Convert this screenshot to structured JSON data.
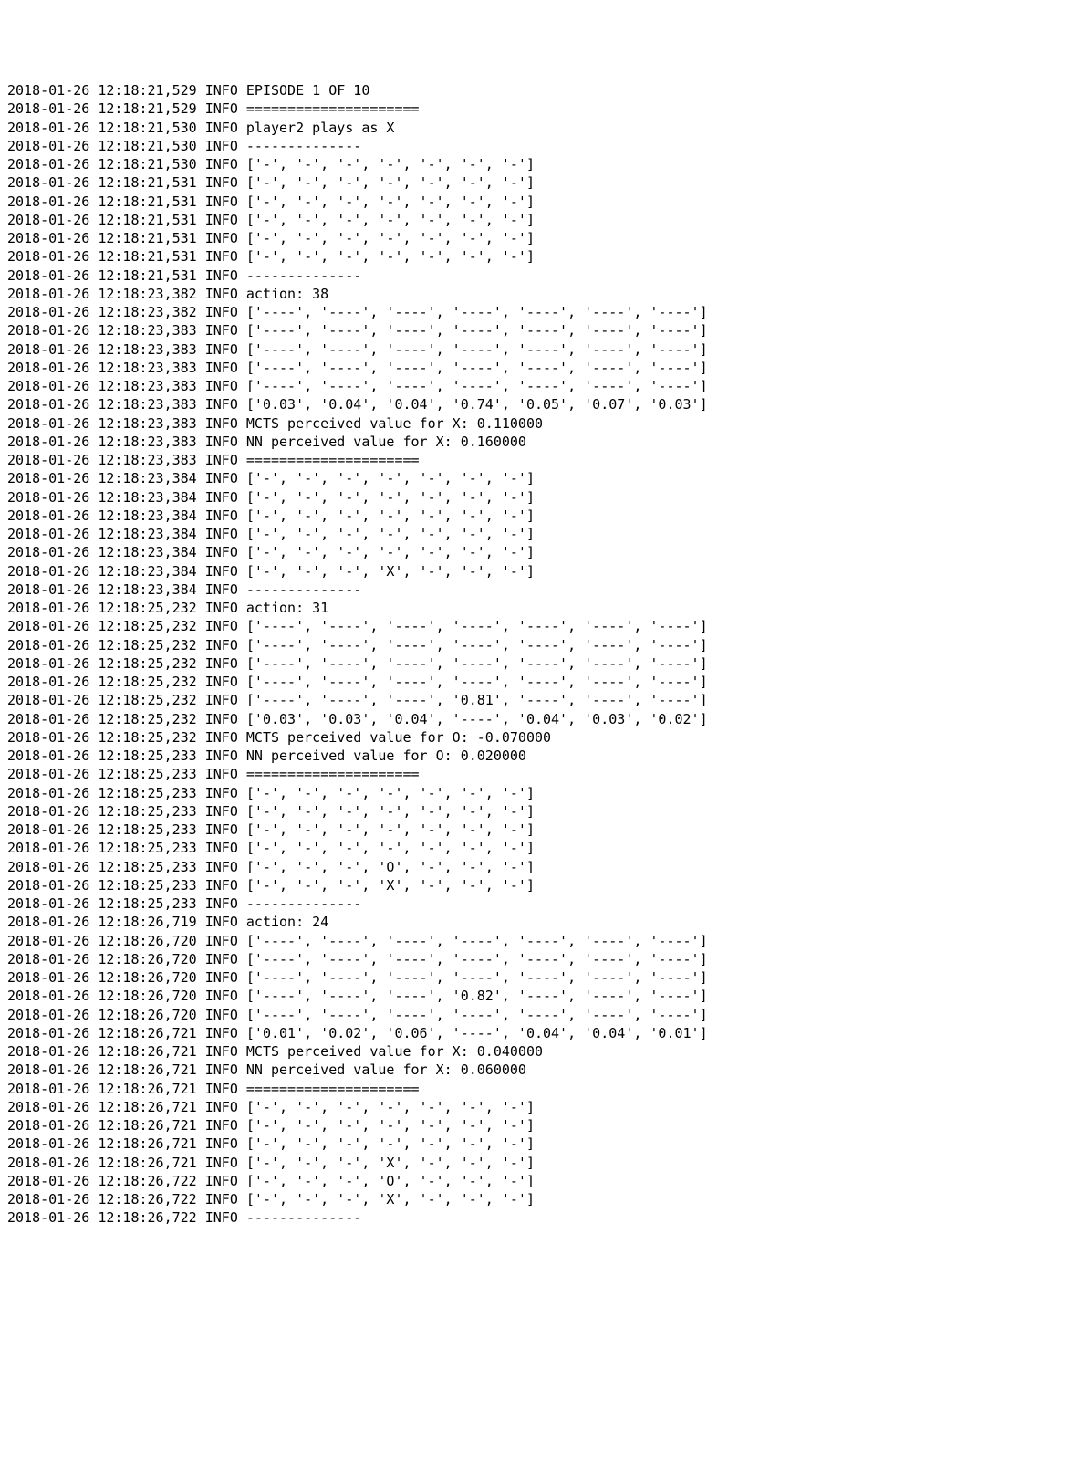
{
  "log_lines": [
    {
      "ts": "2018-01-26 12:18:21,529",
      "level": "INFO",
      "msg": "EPISODE 1 OF 10"
    },
    {
      "ts": "2018-01-26 12:18:21,529",
      "level": "INFO",
      "msg": "====================="
    },
    {
      "ts": "2018-01-26 12:18:21,530",
      "level": "INFO",
      "msg": "player2 plays as X"
    },
    {
      "ts": "2018-01-26 12:18:21,530",
      "level": "INFO",
      "msg": "--------------"
    },
    {
      "ts": "2018-01-26 12:18:21,530",
      "level": "INFO",
      "msg": "['-', '-', '-', '-', '-', '-', '-']"
    },
    {
      "ts": "2018-01-26 12:18:21,531",
      "level": "INFO",
      "msg": "['-', '-', '-', '-', '-', '-', '-']"
    },
    {
      "ts": "2018-01-26 12:18:21,531",
      "level": "INFO",
      "msg": "['-', '-', '-', '-', '-', '-', '-']"
    },
    {
      "ts": "2018-01-26 12:18:21,531",
      "level": "INFO",
      "msg": "['-', '-', '-', '-', '-', '-', '-']"
    },
    {
      "ts": "2018-01-26 12:18:21,531",
      "level": "INFO",
      "msg": "['-', '-', '-', '-', '-', '-', '-']"
    },
    {
      "ts": "2018-01-26 12:18:21,531",
      "level": "INFO",
      "msg": "['-', '-', '-', '-', '-', '-', '-']"
    },
    {
      "ts": "2018-01-26 12:18:21,531",
      "level": "INFO",
      "msg": "--------------"
    },
    {
      "ts": "2018-01-26 12:18:23,382",
      "level": "INFO",
      "msg": "action: 38"
    },
    {
      "ts": "2018-01-26 12:18:23,382",
      "level": "INFO",
      "msg": "['----', '----', '----', '----', '----', '----', '----']"
    },
    {
      "ts": "2018-01-26 12:18:23,383",
      "level": "INFO",
      "msg": "['----', '----', '----', '----', '----', '----', '----']"
    },
    {
      "ts": "2018-01-26 12:18:23,383",
      "level": "INFO",
      "msg": "['----', '----', '----', '----', '----', '----', '----']"
    },
    {
      "ts": "2018-01-26 12:18:23,383",
      "level": "INFO",
      "msg": "['----', '----', '----', '----', '----', '----', '----']"
    },
    {
      "ts": "2018-01-26 12:18:23,383",
      "level": "INFO",
      "msg": "['----', '----', '----', '----', '----', '----', '----']"
    },
    {
      "ts": "2018-01-26 12:18:23,383",
      "level": "INFO",
      "msg": "['0.03', '0.04', '0.04', '0.74', '0.05', '0.07', '0.03']"
    },
    {
      "ts": "2018-01-26 12:18:23,383",
      "level": "INFO",
      "msg": "MCTS perceived value for X: 0.110000"
    },
    {
      "ts": "2018-01-26 12:18:23,383",
      "level": "INFO",
      "msg": "NN perceived value for X: 0.160000"
    },
    {
      "ts": "2018-01-26 12:18:23,383",
      "level": "INFO",
      "msg": "====================="
    },
    {
      "ts": "2018-01-26 12:18:23,384",
      "level": "INFO",
      "msg": "['-', '-', '-', '-', '-', '-', '-']"
    },
    {
      "ts": "2018-01-26 12:18:23,384",
      "level": "INFO",
      "msg": "['-', '-', '-', '-', '-', '-', '-']"
    },
    {
      "ts": "2018-01-26 12:18:23,384",
      "level": "INFO",
      "msg": "['-', '-', '-', '-', '-', '-', '-']"
    },
    {
      "ts": "2018-01-26 12:18:23,384",
      "level": "INFO",
      "msg": "['-', '-', '-', '-', '-', '-', '-']"
    },
    {
      "ts": "2018-01-26 12:18:23,384",
      "level": "INFO",
      "msg": "['-', '-', '-', '-', '-', '-', '-']"
    },
    {
      "ts": "2018-01-26 12:18:23,384",
      "level": "INFO",
      "msg": "['-', '-', '-', 'X', '-', '-', '-']"
    },
    {
      "ts": "2018-01-26 12:18:23,384",
      "level": "INFO",
      "msg": "--------------"
    },
    {
      "ts": "2018-01-26 12:18:25,232",
      "level": "INFO",
      "msg": "action: 31"
    },
    {
      "ts": "2018-01-26 12:18:25,232",
      "level": "INFO",
      "msg": "['----', '----', '----', '----', '----', '----', '----']"
    },
    {
      "ts": "2018-01-26 12:18:25,232",
      "level": "INFO",
      "msg": "['----', '----', '----', '----', '----', '----', '----']"
    },
    {
      "ts": "2018-01-26 12:18:25,232",
      "level": "INFO",
      "msg": "['----', '----', '----', '----', '----', '----', '----']"
    },
    {
      "ts": "2018-01-26 12:18:25,232",
      "level": "INFO",
      "msg": "['----', '----', '----', '----', '----', '----', '----']"
    },
    {
      "ts": "2018-01-26 12:18:25,232",
      "level": "INFO",
      "msg": "['----', '----', '----', '0.81', '----', '----', '----']"
    },
    {
      "ts": "2018-01-26 12:18:25,232",
      "level": "INFO",
      "msg": "['0.03', '0.03', '0.04', '----', '0.04', '0.03', '0.02']"
    },
    {
      "ts": "2018-01-26 12:18:25,232",
      "level": "INFO",
      "msg": "MCTS perceived value for O: -0.070000"
    },
    {
      "ts": "2018-01-26 12:18:25,233",
      "level": "INFO",
      "msg": "NN perceived value for O: 0.020000"
    },
    {
      "ts": "2018-01-26 12:18:25,233",
      "level": "INFO",
      "msg": "====================="
    },
    {
      "ts": "2018-01-26 12:18:25,233",
      "level": "INFO",
      "msg": "['-', '-', '-', '-', '-', '-', '-']"
    },
    {
      "ts": "2018-01-26 12:18:25,233",
      "level": "INFO",
      "msg": "['-', '-', '-', '-', '-', '-', '-']"
    },
    {
      "ts": "2018-01-26 12:18:25,233",
      "level": "INFO",
      "msg": "['-', '-', '-', '-', '-', '-', '-']"
    },
    {
      "ts": "2018-01-26 12:18:25,233",
      "level": "INFO",
      "msg": "['-', '-', '-', '-', '-', '-', '-']"
    },
    {
      "ts": "2018-01-26 12:18:25,233",
      "level": "INFO",
      "msg": "['-', '-', '-', 'O', '-', '-', '-']"
    },
    {
      "ts": "2018-01-26 12:18:25,233",
      "level": "INFO",
      "msg": "['-', '-', '-', 'X', '-', '-', '-']"
    },
    {
      "ts": "2018-01-26 12:18:25,233",
      "level": "INFO",
      "msg": "--------------"
    },
    {
      "ts": "2018-01-26 12:18:26,719",
      "level": "INFO",
      "msg": "action: 24"
    },
    {
      "ts": "2018-01-26 12:18:26,720",
      "level": "INFO",
      "msg": "['----', '----', '----', '----', '----', '----', '----']"
    },
    {
      "ts": "2018-01-26 12:18:26,720",
      "level": "INFO",
      "msg": "['----', '----', '----', '----', '----', '----', '----']"
    },
    {
      "ts": "2018-01-26 12:18:26,720",
      "level": "INFO",
      "msg": "['----', '----', '----', '----', '----', '----', '----']"
    },
    {
      "ts": "2018-01-26 12:18:26,720",
      "level": "INFO",
      "msg": "['----', '----', '----', '0.82', '----', '----', '----']"
    },
    {
      "ts": "2018-01-26 12:18:26,720",
      "level": "INFO",
      "msg": "['----', '----', '----', '----', '----', '----', '----']"
    },
    {
      "ts": "2018-01-26 12:18:26,721",
      "level": "INFO",
      "msg": "['0.01', '0.02', '0.06', '----', '0.04', '0.04', '0.01']"
    },
    {
      "ts": "2018-01-26 12:18:26,721",
      "level": "INFO",
      "msg": "MCTS perceived value for X: 0.040000"
    },
    {
      "ts": "2018-01-26 12:18:26,721",
      "level": "INFO",
      "msg": "NN perceived value for X: 0.060000"
    },
    {
      "ts": "2018-01-26 12:18:26,721",
      "level": "INFO",
      "msg": "====================="
    },
    {
      "ts": "2018-01-26 12:18:26,721",
      "level": "INFO",
      "msg": "['-', '-', '-', '-', '-', '-', '-']"
    },
    {
      "ts": "2018-01-26 12:18:26,721",
      "level": "INFO",
      "msg": "['-', '-', '-', '-', '-', '-', '-']"
    },
    {
      "ts": "2018-01-26 12:18:26,721",
      "level": "INFO",
      "msg": "['-', '-', '-', '-', '-', '-', '-']"
    },
    {
      "ts": "2018-01-26 12:18:26,721",
      "level": "INFO",
      "msg": "['-', '-', '-', 'X', '-', '-', '-']"
    },
    {
      "ts": "2018-01-26 12:18:26,722",
      "level": "INFO",
      "msg": "['-', '-', '-', 'O', '-', '-', '-']"
    },
    {
      "ts": "2018-01-26 12:18:26,722",
      "level": "INFO",
      "msg": "['-', '-', '-', 'X', '-', '-', '-']"
    },
    {
      "ts": "2018-01-26 12:18:26,722",
      "level": "INFO",
      "msg": "--------------"
    }
  ]
}
